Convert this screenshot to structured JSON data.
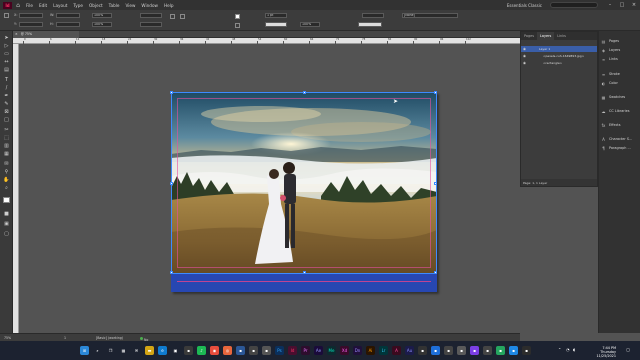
{
  "menubar": {
    "logo": "Id",
    "items": [
      "File",
      "Edit",
      "Layout",
      "Type",
      "Object",
      "Table",
      "View",
      "Window",
      "Help"
    ],
    "workspace": "Essentials Classic"
  },
  "controlbar": {
    "x_value": "",
    "y_value": "",
    "zoom_value": "100%",
    "stroke_weight": "1 pt",
    "opacity_value": "100%",
    "measure_value": "",
    "style_value": "[None]"
  },
  "document": {
    "tab_label": "@ 75%"
  },
  "ruler": {
    "labels": [
      "0",
      "6",
      "12",
      "18",
      "24",
      "30",
      "36",
      "42",
      "48",
      "54",
      "60",
      "66",
      "72",
      "78",
      "84",
      "90",
      "96",
      "102"
    ]
  },
  "layers_panel": {
    "tabs": [
      "Pages",
      "Layers",
      "Links"
    ],
    "rows": [
      {
        "name": "Layer 1"
      },
      {
        "name": "<pexels-cuh-1649893.jpg>"
      },
      {
        "name": "<rectangle>"
      }
    ],
    "footer": "Page: 1, 1 Layer"
  },
  "dock": {
    "items": [
      {
        "label": "Pages",
        "icon": "pages-icon"
      },
      {
        "label": "Layers",
        "icon": "layers-icon"
      },
      {
        "label": "Links",
        "icon": "links-icon"
      },
      {
        "label": "Stroke",
        "icon": "stroke-icon"
      },
      {
        "label": "Color",
        "icon": "color-icon"
      },
      {
        "label": "Swatches",
        "icon": "swatches-icon"
      },
      {
        "label": "CC Libraries",
        "icon": "cc-libraries-icon"
      },
      {
        "label": "Effects",
        "icon": "effects-icon"
      },
      {
        "label": "Character S...",
        "icon": "character-styles-icon"
      },
      {
        "label": "Paragraph ...",
        "icon": "paragraph-styles-icon"
      }
    ]
  },
  "statusbar": {
    "zoom": "75%",
    "page": "1",
    "style": "[Basic] (working)",
    "errors": "No errors"
  },
  "taskbar": {
    "time": "7:44 PM",
    "day": "Thursday",
    "date": "11/25/2021"
  },
  "colors": {
    "accent_blue": "#2747b2",
    "selection": "#3d8bff",
    "indesign": "#ff3366"
  }
}
